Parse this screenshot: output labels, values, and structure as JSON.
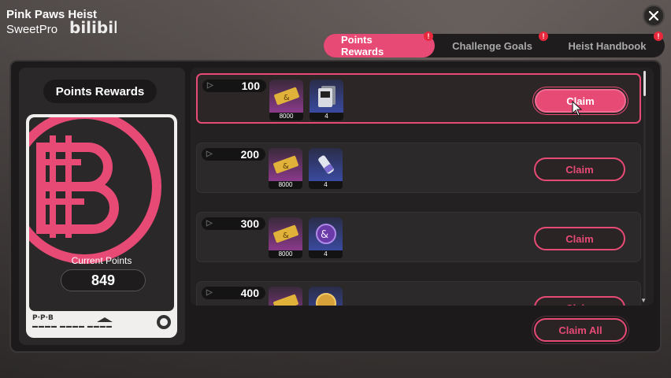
{
  "header": {
    "event_title": "Pink Paws Heist",
    "subtitle": "SweetPro",
    "watermark": "bilibili"
  },
  "tabs": [
    {
      "label": "Points Rewards",
      "active": true,
      "badge": "!"
    },
    {
      "label": "Challenge Goals",
      "active": false,
      "badge": "!"
    },
    {
      "label": "Heist Handbook",
      "active": false,
      "badge": "!"
    }
  ],
  "left_panel": {
    "title": "Points Rewards",
    "current_points_label": "Current Points",
    "current_points": "849",
    "card_footer_brand": "P·P·B",
    "card_footer_code": "▬▬▬▬ ▬▬▬▬ ▬▬▬▬"
  },
  "rewards": [
    {
      "points": "100",
      "items": [
        {
          "icon": "denny-ticket-icon",
          "qty": "8000",
          "rarity": "purple"
        },
        {
          "icon": "card-pack-icon",
          "qty": "4",
          "rarity": "blue"
        }
      ],
      "claim_label": "Claim",
      "highlighted": true
    },
    {
      "points": "200",
      "items": [
        {
          "icon": "denny-ticket-icon",
          "qty": "8000",
          "rarity": "purple"
        },
        {
          "icon": "tube-material-icon",
          "qty": "4",
          "rarity": "blue"
        }
      ],
      "claim_label": "Claim",
      "highlighted": false
    },
    {
      "points": "300",
      "items": [
        {
          "icon": "denny-ticket-icon",
          "qty": "8000",
          "rarity": "purple"
        },
        {
          "icon": "purple-coin-icon",
          "qty": "4",
          "rarity": "blue"
        }
      ],
      "claim_label": "Claim",
      "highlighted": false
    },
    {
      "points": "400",
      "items": [
        {
          "icon": "denny-ticket-icon",
          "qty": "",
          "rarity": "purple"
        },
        {
          "icon": "gold-coin-icon",
          "qty": "",
          "rarity": "blue"
        }
      ],
      "claim_label": "Claim",
      "highlighted": false
    }
  ],
  "claim_all_label": "Claim All",
  "colors": {
    "accent": "#e84a76",
    "panel": "#1c1a1b",
    "row": "#2b2929"
  }
}
